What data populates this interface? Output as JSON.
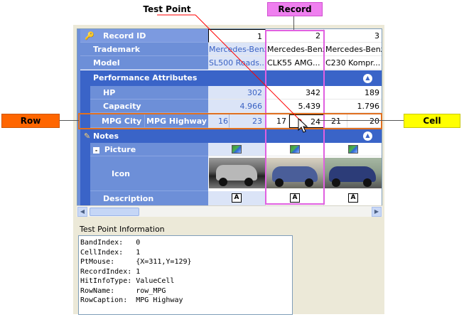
{
  "callouts": {
    "test_point": "Test Point",
    "record": "Record",
    "row": "Row",
    "cell": "Cell"
  },
  "colors": {
    "test_point_line": "#ff0000",
    "record_frame": "#e060e0",
    "record_label_bg": "#ef7fef",
    "row_label_bg": "#ff6600",
    "row_frame": "#e07020",
    "cell_label_bg": "#ffff00"
  },
  "grid": {
    "record_id": {
      "label": "Record ID",
      "values": [
        "1",
        "2",
        "3"
      ]
    },
    "trademark": {
      "label": "Trademark",
      "values": [
        "Mercedes-Benz",
        "Mercedes-Benz",
        "Mercedes-Benz"
      ]
    },
    "model": {
      "label": "Model",
      "values": [
        "SL500 Roads...",
        "CLK55 AMG...",
        "C230 Kompr..."
      ]
    },
    "performance": {
      "label": "Performance Attributes"
    },
    "hp": {
      "label": "HP",
      "values": [
        "302",
        "342",
        "189"
      ]
    },
    "capacity": {
      "label": "Capacity",
      "values": [
        "4.966",
        "5.439",
        "1.796"
      ]
    },
    "mpg": {
      "label_city": "MPG City",
      "label_highway": "MPG Highway",
      "city": [
        "16",
        "17",
        "21"
      ],
      "highway": [
        "23",
        "24",
        "20"
      ]
    },
    "notes": {
      "label": "Notes"
    },
    "picture": {
      "label": "Picture"
    },
    "icon": {
      "label": "Icon"
    },
    "description": {
      "label": "Description"
    }
  },
  "info": {
    "title": "Test Point Information",
    "lines": [
      "BandIndex:   0",
      "CellIndex:   1",
      "PtMouse:     {X=311,Y=129}",
      "RecordIndex: 1",
      "HitInfoType: ValueCell",
      "RowName:     row_MPG",
      "RowCaption:  MPG Highway"
    ]
  },
  "icons": {
    "record_id": "key-icon",
    "notes": "pencil-notes-icon",
    "picture_expand": "minus-icon",
    "collapse": "chevron-up-icon",
    "image": "image-icon",
    "text": "text-document-icon",
    "cursor": "mouse-pointer-icon"
  }
}
